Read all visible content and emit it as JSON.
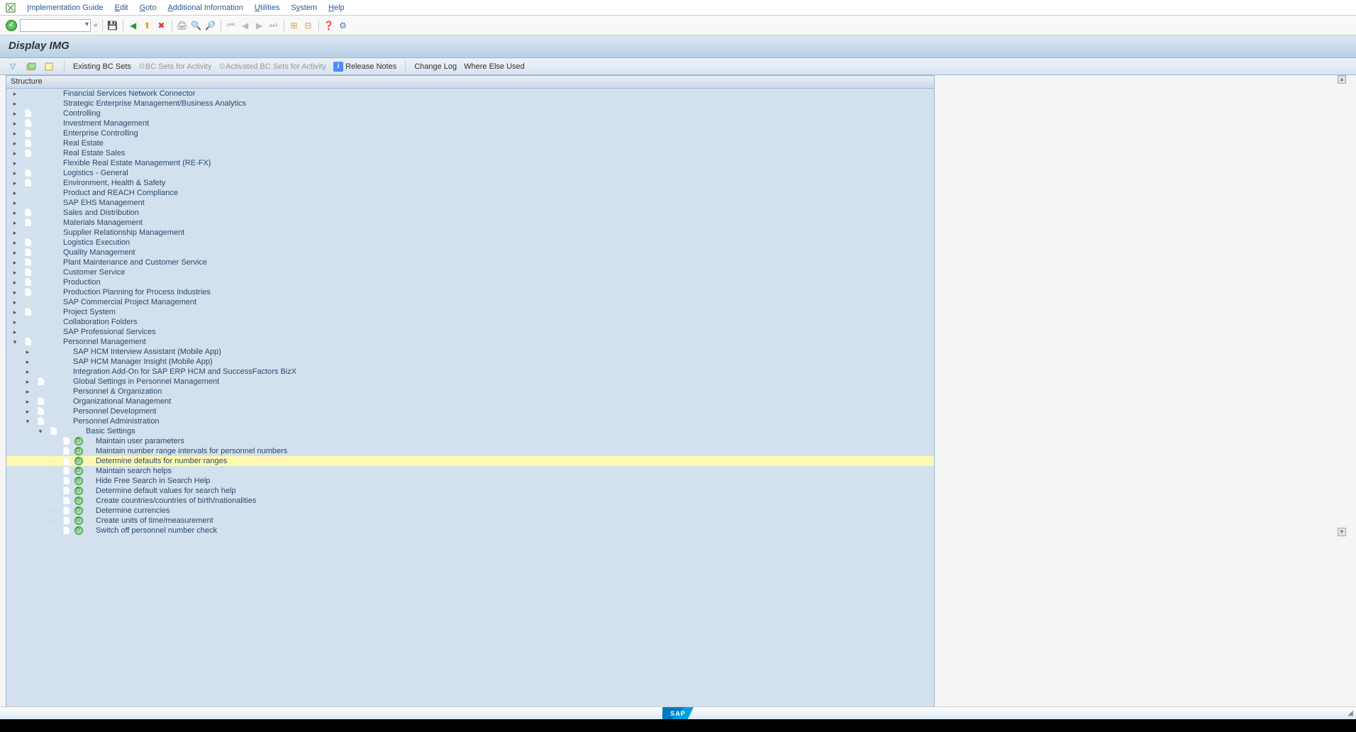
{
  "menubar": [
    "Implementation Guide",
    "Edit",
    "Goto",
    "Additional Information",
    "Utilities",
    "System",
    "Help"
  ],
  "page_title": "Display IMG",
  "app_toolbar": {
    "existing": "Existing BC Sets",
    "bc_sets": "BC Sets for Activity",
    "activated": "Activated BC Sets for Activity",
    "release": "Release Notes",
    "change": "Change Log",
    "where": "Where Else Used"
  },
  "structure_title": "Structure",
  "tree": [
    {
      "l": 0,
      "exp": "closed",
      "doc": false,
      "act": false,
      "label": "Financial Services Network Connector"
    },
    {
      "l": 0,
      "exp": "closed",
      "doc": false,
      "act": false,
      "label": "Strategic Enterprise Management/Business Analytics"
    },
    {
      "l": 0,
      "exp": "closed",
      "doc": true,
      "act": false,
      "label": "Controlling"
    },
    {
      "l": 0,
      "exp": "closed",
      "doc": true,
      "act": false,
      "label": "Investment Management"
    },
    {
      "l": 0,
      "exp": "closed",
      "doc": true,
      "act": false,
      "label": "Enterprise Controlling"
    },
    {
      "l": 0,
      "exp": "closed",
      "doc": true,
      "act": false,
      "label": "Real Estate"
    },
    {
      "l": 0,
      "exp": "closed",
      "doc": true,
      "act": false,
      "label": "Real Estate Sales"
    },
    {
      "l": 0,
      "exp": "closed",
      "doc": false,
      "act": false,
      "label": "Flexible Real Estate Management (RE-FX)"
    },
    {
      "l": 0,
      "exp": "closed",
      "doc": true,
      "act": false,
      "label": "Logistics - General"
    },
    {
      "l": 0,
      "exp": "closed",
      "doc": true,
      "act": false,
      "label": "Environment, Health & Safety"
    },
    {
      "l": 0,
      "exp": "closed",
      "doc": false,
      "act": false,
      "label": "Product and REACH Compliance"
    },
    {
      "l": 0,
      "exp": "closed",
      "doc": false,
      "act": false,
      "label": "SAP EHS Management"
    },
    {
      "l": 0,
      "exp": "closed",
      "doc": true,
      "act": false,
      "label": "Sales and Distribution"
    },
    {
      "l": 0,
      "exp": "closed",
      "doc": true,
      "act": false,
      "label": "Materials Management"
    },
    {
      "l": 0,
      "exp": "closed",
      "doc": false,
      "act": false,
      "label": "Supplier Relationship Management"
    },
    {
      "l": 0,
      "exp": "closed",
      "doc": true,
      "act": false,
      "label": "Logistics Execution"
    },
    {
      "l": 0,
      "exp": "closed",
      "doc": true,
      "act": false,
      "label": "Quality Management"
    },
    {
      "l": 0,
      "exp": "closed",
      "doc": true,
      "act": false,
      "label": "Plant Maintenance and Customer Service"
    },
    {
      "l": 0,
      "exp": "closed",
      "doc": true,
      "act": false,
      "label": "Customer Service"
    },
    {
      "l": 0,
      "exp": "closed",
      "doc": true,
      "act": false,
      "label": "Production"
    },
    {
      "l": 0,
      "exp": "closed",
      "doc": true,
      "act": false,
      "label": "Production Planning for Process Industries"
    },
    {
      "l": 0,
      "exp": "closed",
      "doc": false,
      "act": false,
      "label": "SAP Commercial Project Management"
    },
    {
      "l": 0,
      "exp": "closed",
      "doc": true,
      "act": false,
      "label": "Project System"
    },
    {
      "l": 0,
      "exp": "closed",
      "doc": false,
      "act": false,
      "label": "Collaboration Folders"
    },
    {
      "l": 0,
      "exp": "closed",
      "doc": false,
      "act": false,
      "label": "SAP Professional Services"
    },
    {
      "l": 0,
      "exp": "open",
      "doc": true,
      "act": false,
      "label": "Personnel Management"
    },
    {
      "l": 1,
      "exp": "closed",
      "doc": false,
      "act": false,
      "label": "SAP HCM Interview Assistant (Mobile App)"
    },
    {
      "l": 1,
      "exp": "closed",
      "doc": false,
      "act": false,
      "label": "SAP HCM Manager Insight (Mobile App)"
    },
    {
      "l": 1,
      "exp": "closed",
      "doc": false,
      "act": false,
      "label": "Integration Add-On for SAP ERP HCM and SuccessFactors BizX"
    },
    {
      "l": 1,
      "exp": "closed",
      "doc": true,
      "act": false,
      "label": "Global Settings in Personnel Management"
    },
    {
      "l": 1,
      "exp": "closed",
      "doc": false,
      "act": false,
      "label": "Personnel & Organization"
    },
    {
      "l": 1,
      "exp": "closed",
      "doc": true,
      "act": false,
      "label": "Organizational Management"
    },
    {
      "l": 1,
      "exp": "closed",
      "doc": true,
      "act": false,
      "label": "Personnel Development"
    },
    {
      "l": 1,
      "exp": "open",
      "doc": true,
      "act": false,
      "label": "Personnel Administration"
    },
    {
      "l": 2,
      "exp": "open",
      "doc": true,
      "act": false,
      "label": "Basic Settings"
    },
    {
      "l": 3,
      "exp": "leaf",
      "doc": true,
      "act": true,
      "label": "Maintain user parameters"
    },
    {
      "l": 3,
      "exp": "leaf",
      "doc": true,
      "act": true,
      "label": "Maintain number range intervals for personnel numbers"
    },
    {
      "l": 3,
      "exp": "leaf",
      "doc": true,
      "act": true,
      "label": "Determine defaults for number ranges",
      "selected": true
    },
    {
      "l": 3,
      "exp": "leaf",
      "doc": true,
      "act": true,
      "label": "Maintain search helps"
    },
    {
      "l": 3,
      "exp": "leaf",
      "doc": true,
      "act": true,
      "label": "Hide Free Search in Search Help"
    },
    {
      "l": 3,
      "exp": "leaf",
      "doc": true,
      "act": true,
      "label": "Determine default values for search help"
    },
    {
      "l": 3,
      "exp": "leaf",
      "doc": true,
      "act": true,
      "label": "Create countries/countries of birth/nationalities"
    },
    {
      "l": 3,
      "exp": "leaf",
      "doc": true,
      "act": true,
      "label": "Determine currencies"
    },
    {
      "l": 3,
      "exp": "leaf",
      "doc": true,
      "act": true,
      "label": "Create units of time/measurement"
    },
    {
      "l": 3,
      "exp": "leaf",
      "doc": true,
      "act": true,
      "label": "Switch off personnel number check"
    }
  ],
  "sap_logo": "SAP"
}
